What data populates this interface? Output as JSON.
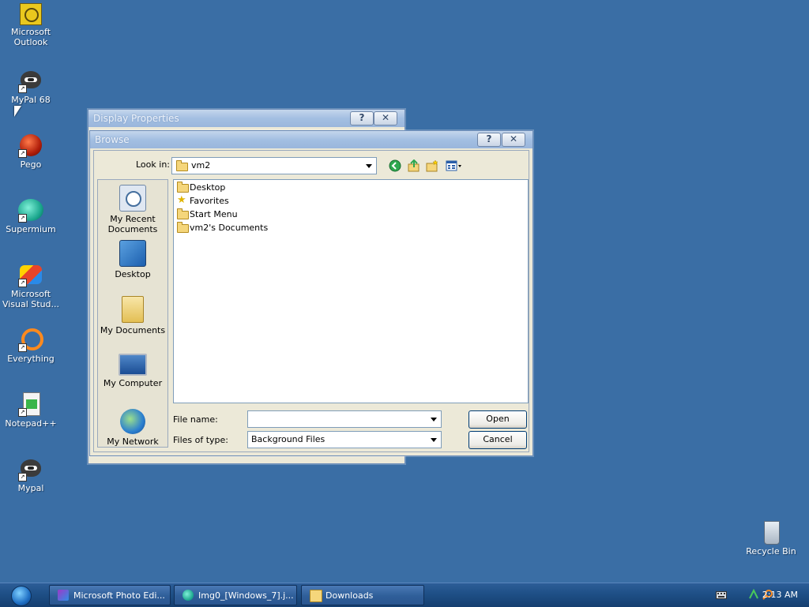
{
  "desktop": {
    "icons": [
      {
        "label": "Microsoft Outlook",
        "icon": "outlook-icon"
      },
      {
        "label": "MyPal 68",
        "icon": "mypal-icon"
      },
      {
        "label": "Pego",
        "icon": "pego-icon"
      },
      {
        "label": "Supermium",
        "icon": "supermium-icon"
      },
      {
        "label": "Microsoft Visual Stud...",
        "icon": "visual-studio-icon"
      },
      {
        "label": "Everything",
        "icon": "everything-icon"
      },
      {
        "label": "Notepad++",
        "icon": "notepad-plus-plus-icon"
      },
      {
        "label": "Mypal",
        "icon": "mypal-icon"
      }
    ],
    "recycle_bin": {
      "label": "Recycle Bin",
      "icon": "recycle-bin-icon"
    }
  },
  "display_properties": {
    "title": "Display Properties"
  },
  "browse": {
    "title": "Browse",
    "look_in_label": "Look in:",
    "look_in_value": "vm2",
    "places": [
      {
        "label": "My Recent Documents",
        "icon": "recent-documents-icon"
      },
      {
        "label": "Desktop",
        "icon": "desktop-icon"
      },
      {
        "label": "My Documents",
        "icon": "my-documents-icon"
      },
      {
        "label": "My Computer",
        "icon": "my-computer-icon"
      },
      {
        "label": "My Network",
        "icon": "my-network-icon"
      }
    ],
    "files": [
      {
        "name": "Desktop",
        "icon": "folder-icon"
      },
      {
        "name": "Favorites",
        "icon": "favorites-star-icon"
      },
      {
        "name": "Start Menu",
        "icon": "folder-icon"
      },
      {
        "name": "vm2's Documents",
        "icon": "folder-icon"
      }
    ],
    "file_name_label": "File name:",
    "file_name_value": "",
    "file_type_label": "Files of type:",
    "file_type_value": "Background Files",
    "buttons": {
      "open": "Open",
      "cancel": "Cancel"
    },
    "help_glyph": "?",
    "close_glyph": "✕"
  },
  "taskbar": {
    "items": [
      {
        "label": "Microsoft Photo Edi...",
        "icon": "photo-editor-icon"
      },
      {
        "label": "Img0_[Windows_7].j...",
        "icon": "supermium-icon"
      },
      {
        "label": "Downloads",
        "icon": "folder-icon"
      }
    ],
    "clock": "2:13 AM"
  }
}
